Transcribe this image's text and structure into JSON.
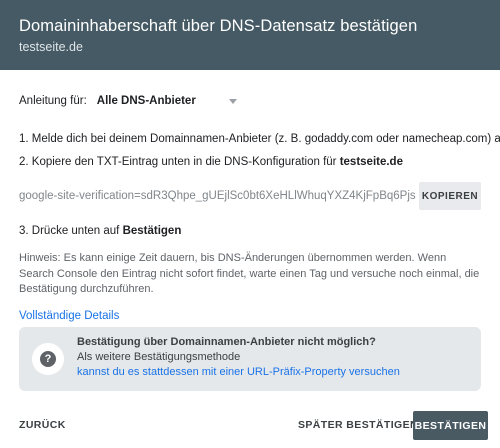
{
  "header": {
    "title": "Domaininhaberschaft über DNS-Datensatz bestätigen",
    "subtitle": "testseite.de"
  },
  "guide": {
    "label": "Anleitung für:",
    "selected": "Alle DNS-Anbieter"
  },
  "steps": {
    "step1": "1. Melde dich bei deinem Domainnamen-Anbieter (z. B. godaddy.com oder namecheap.com) an",
    "step2_prefix": "2. Kopiere den TXT-Eintrag unten in die DNS-Konfiguration für ",
    "step2_domain": "testseite.de",
    "step3_prefix": "3. Drücke unten auf ",
    "step3_bold": "Bestätigen"
  },
  "txt_record": {
    "value": "google-site-verification=sdR3Qhpe_gUEjlSc0bt6XeHLlWhuqYXZ4KjFpBq6Pjs",
    "copy_label": "KOPIEREN"
  },
  "hint": "Hinweis: Es kann einige Zeit dauern, bis DNS-Änderungen übernommen werden. Wenn Search Console den Eintrag nicht sofort findet, warte einen Tag und versuche noch einmal, die Bestätigung durchzuführen.",
  "details_link": "Vollständige Details",
  "info_box": {
    "title": "Bestätigung über Domainnamen-Anbieter nicht möglich?",
    "subtitle": "Als weitere Bestätigungsmethode",
    "link": "kannst du es stattdessen mit einer URL-Präfix-Property versuchen",
    "icon": "?"
  },
  "footer": {
    "back": "ZURÜCK",
    "later": "SPÄTER BESTÄTIGEN",
    "confirm": "BESTÄTIGEN"
  }
}
